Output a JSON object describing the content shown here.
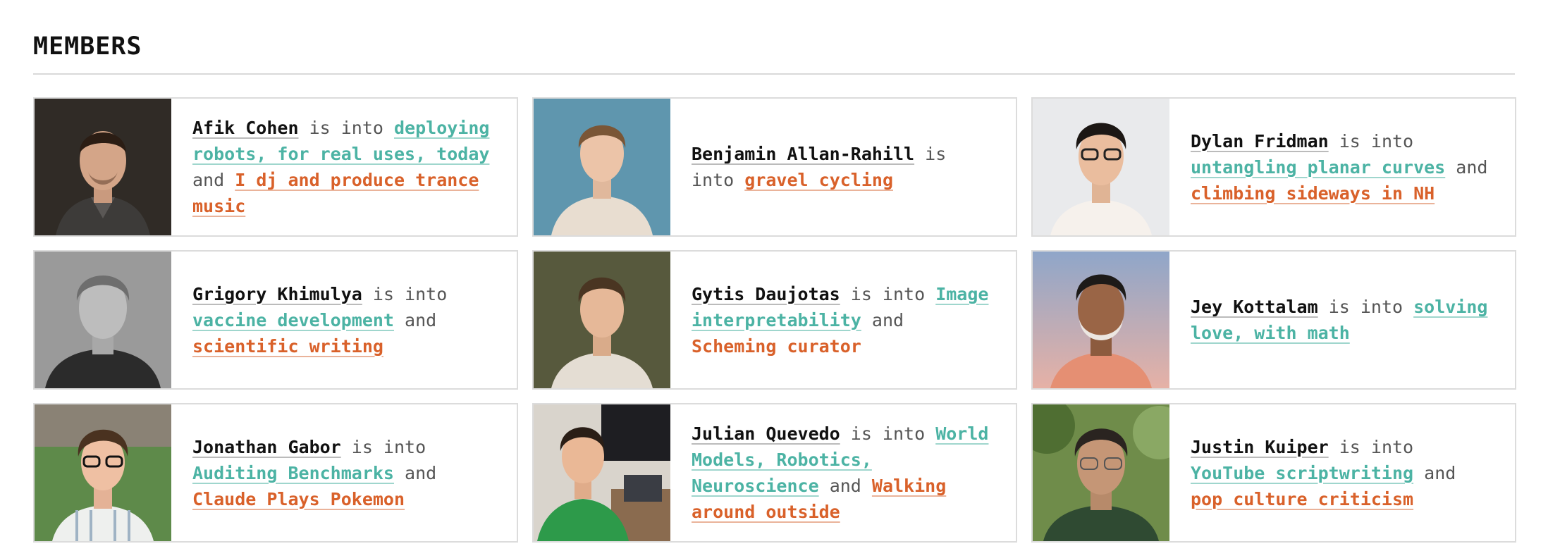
{
  "section": {
    "title": "MEMBERS"
  },
  "connectors": {
    "is_into": "is into",
    "and": "and"
  },
  "colors": {
    "interest_primary": "#4cb3a4",
    "interest_secondary": "#d9612a",
    "name": "#111111",
    "text": "#555555"
  },
  "members": [
    {
      "name": "Afik Cohen",
      "interest1": "deploying robots, for real uses, today",
      "interest2": "I dj and produce trance music",
      "photo": "portrait-photo"
    },
    {
      "name": "Benjamin Allan-Rahill",
      "interest1": "gravel cycling",
      "interest2": "",
      "photo": "portrait-photo"
    },
    {
      "name": "Dylan Fridman",
      "interest1": "untangling planar curves",
      "interest2": "climbing sideways in NH",
      "photo": "portrait-photo"
    },
    {
      "name": "Grigory Khimulya",
      "interest1": "vaccine development",
      "interest2": "scientific writing",
      "photo": "portrait-photo"
    },
    {
      "name": "Gytis Daujotas",
      "interest1": "Image interpretability",
      "interest2": "Scheming curator",
      "photo": "portrait-photo"
    },
    {
      "name": "Jey Kottalam",
      "interest1": "solving love, with math",
      "interest2": "",
      "photo": "portrait-photo"
    },
    {
      "name": "Jonathan Gabor",
      "interest1": "Auditing Benchmarks",
      "interest2": "Claude Plays Pokemon",
      "photo": "portrait-photo"
    },
    {
      "name": "Julian Quevedo",
      "interest1": "World Models, Robotics, Neuroscience",
      "interest2": "Walking around outside",
      "photo": "portrait-photo"
    },
    {
      "name": "Justin Kuiper",
      "interest1": "YouTube scriptwriting",
      "interest2": "pop culture criticism",
      "photo": "portrait-photo"
    }
  ]
}
